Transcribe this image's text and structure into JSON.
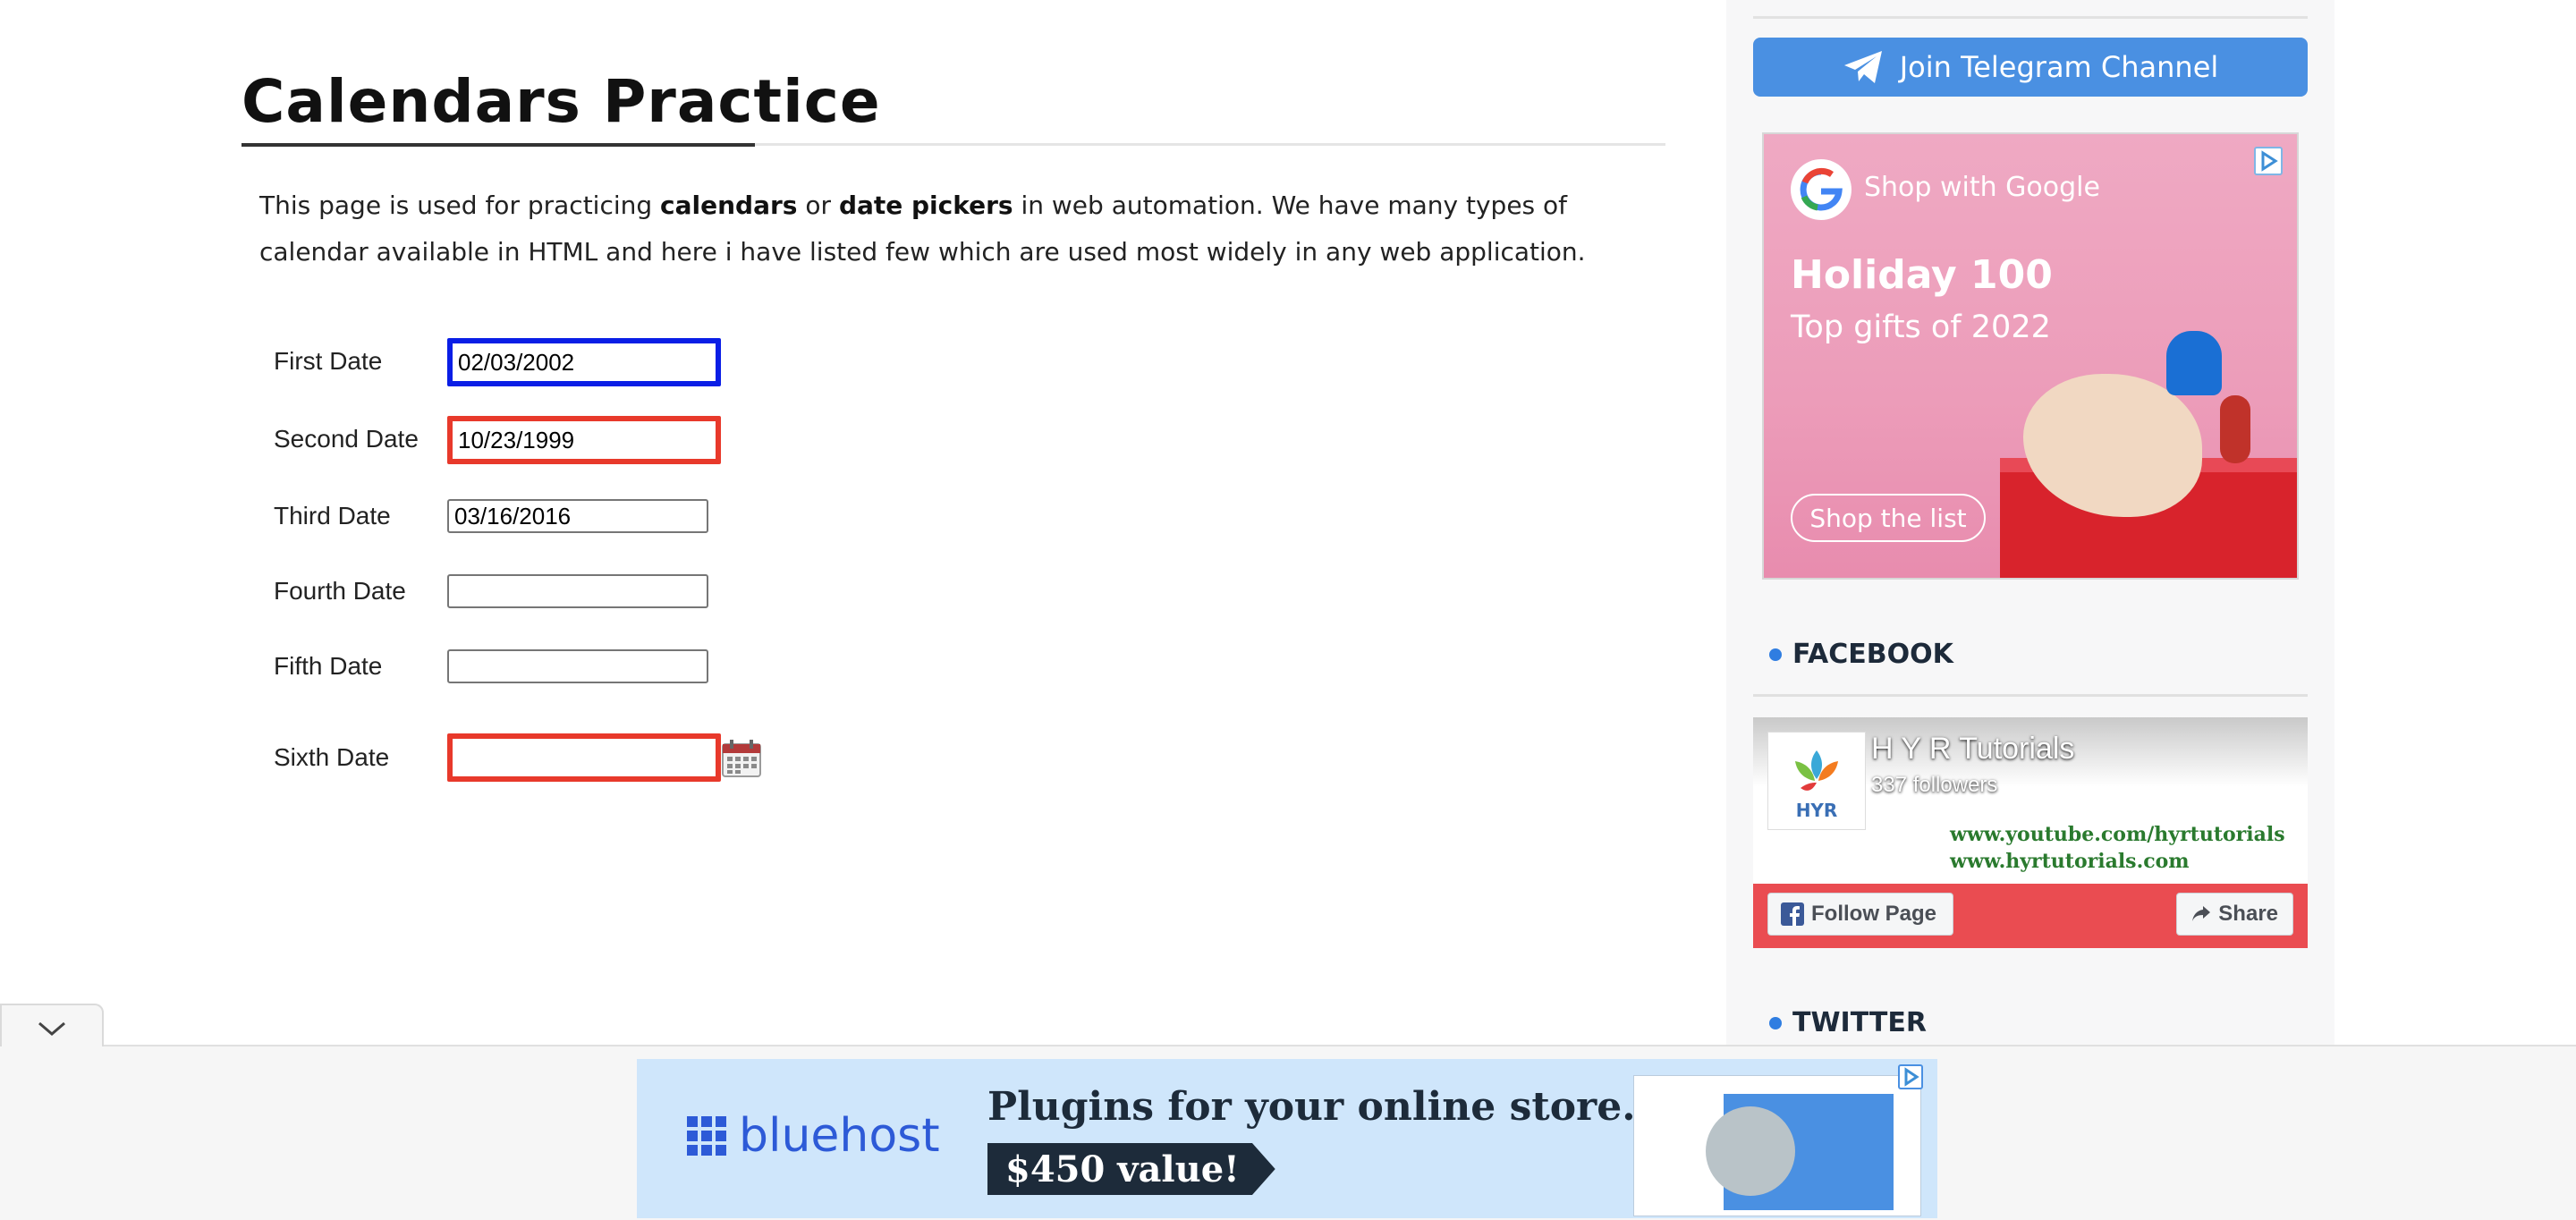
{
  "main": {
    "title": "Calendars Practice",
    "intro": {
      "part1": "This page is used for practicing ",
      "bold1": "calendars",
      "part2": " or ",
      "bold2": "date pickers",
      "part3": " in web automation. We have many types of calendar available in HTML and here i have listed few which are used most widely in any web application."
    },
    "fields": [
      {
        "label": "First Date",
        "value": "02/03/2002"
      },
      {
        "label": "Second Date",
        "value": "10/23/1999"
      },
      {
        "label": "Third Date",
        "value": "03/16/2016"
      },
      {
        "label": "Fourth Date",
        "value": ""
      },
      {
        "label": "Fifth Date",
        "value": ""
      },
      {
        "label": "Sixth Date",
        "value": ""
      }
    ]
  },
  "sidebar": {
    "telegram_label": "Join Telegram Channel",
    "ad": {
      "brand": "Shop with Google",
      "headline": "Holiday 100",
      "subline": "Top gifts of 2022",
      "cta": "Shop the list"
    },
    "facebook": {
      "heading": "FACEBOOK",
      "page_name": "H Y R Tutorials",
      "followers": "337 followers",
      "logo_text": "HYR",
      "youtube": "www.youtube.com/hyrtutorials",
      "site": "www.hyrtutorials.com",
      "follow_label": "Follow Page",
      "share_label": "Share"
    },
    "twitter_heading": "TWITTER"
  },
  "bottom_ad": {
    "brand": "bluehost",
    "headline": "Plugins for your online store.",
    "value": "$450 value!"
  },
  "colors": {
    "accent_blue": "#0a1ee6",
    "error_red": "#e8392b",
    "telegram": "#4a90e2"
  }
}
